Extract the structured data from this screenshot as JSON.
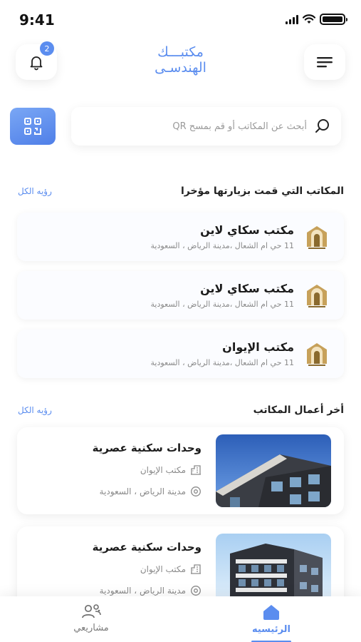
{
  "status_bar": {
    "time": "9:41"
  },
  "header": {
    "title_line1": "مكتبـــك",
    "title_line2": "الهندسـى",
    "notification_count": "2"
  },
  "search": {
    "placeholder": "أبحث عن المكاتب  أو قم بمسح QR"
  },
  "recent_offices": {
    "title": "المكاتب التي قمت بزيارتها مؤخرا",
    "see_all": "رؤيه الكل",
    "items": [
      {
        "name": "مكتب سكاي لاين",
        "address": "11 حي ام الشعال ،مدينة الرياض ، السعودية"
      },
      {
        "name": "مكتب سكاي لاين",
        "address": "11 حي ام الشعال ،مدينة الرياض ، السعودية"
      },
      {
        "name": "مكتب الإيوان",
        "address": "11 حي ام الشعال ،مدينة الرياض ، السعودية"
      }
    ]
  },
  "latest_works": {
    "title": "أخر أعمال المكاتب",
    "see_all": "رؤيه الكل",
    "items": [
      {
        "title": "وحدات سكنية عصرية",
        "office": "مكتب الإيوان",
        "location": "مدينة الرياض ، السعودية"
      },
      {
        "title": "وحدات سكنية عصرية",
        "office": "مكتب الإيوان",
        "location": "مدينة الرياض ، السعودية"
      }
    ]
  },
  "bottom_nav": {
    "home_label": "الرئيسيه",
    "projects_label": "مشاريعي"
  },
  "colors": {
    "accent": "#5b8def",
    "text": "#1b1b1b",
    "muted": "#8a8a8a"
  }
}
